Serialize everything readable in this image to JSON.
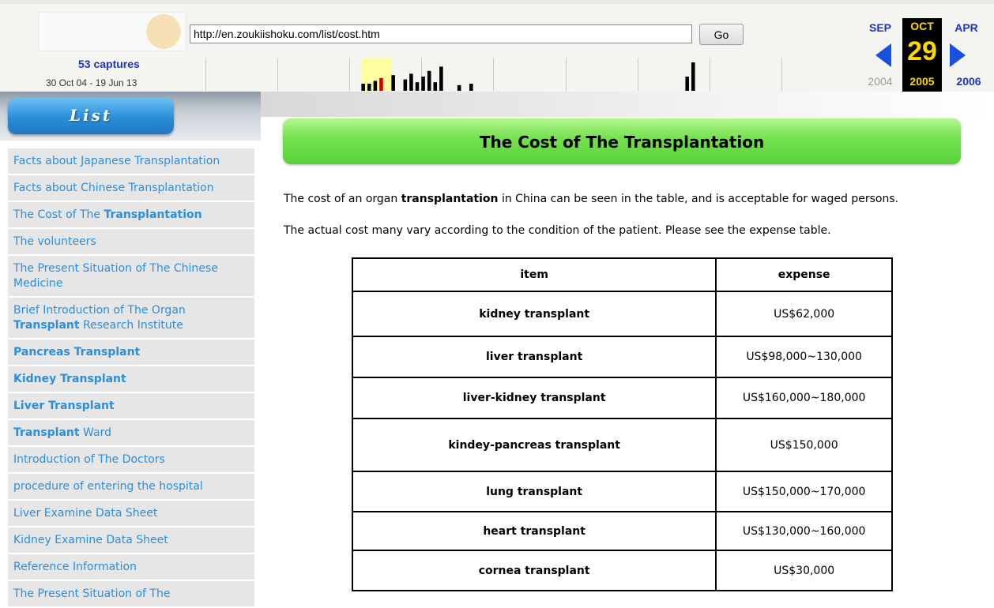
{
  "wayback": {
    "url": "http://en.zoukiishoku.com/list/cost.htm",
    "go_label": "Go",
    "captures_label": "53 captures",
    "capture_range": "30 Oct 04 - 19 Jun 13",
    "prev_month": "SEP",
    "current_month": "OCT",
    "next_month": "APR",
    "current_day": "29",
    "prev_year": "2004",
    "current_year": "2005",
    "next_year": "2006",
    "sparkline_bars": [
      {
        "month": 26,
        "height": 0.25
      },
      {
        "month": 27,
        "height": 0.25
      },
      {
        "month": 28,
        "height": 0.35
      },
      {
        "month": 29,
        "height": 0.45
      },
      {
        "month": 31,
        "height": 0.55
      },
      {
        "month": 33,
        "height": 0.4
      },
      {
        "month": 34,
        "height": 0.6
      },
      {
        "month": 35,
        "height": 0.3
      },
      {
        "month": 36,
        "height": 0.5
      },
      {
        "month": 37,
        "height": 0.7
      },
      {
        "month": 38,
        "height": 0.3
      },
      {
        "month": 39,
        "height": 0.85
      },
      {
        "month": 42,
        "height": 0.2
      },
      {
        "month": 44,
        "height": 0.25
      },
      {
        "month": 80,
        "height": 0.5
      },
      {
        "month": 81,
        "height": 1.0
      }
    ],
    "colors": {
      "accent": "#1a35c9",
      "current": "#ffd700",
      "highlight": "#ffffa0"
    }
  },
  "sidebar": {
    "title": "List",
    "items": [
      {
        "parts": [
          {
            "t": "Facts about Japanese Transplantation",
            "b": false
          }
        ]
      },
      {
        "parts": [
          {
            "t": "Facts about Chinese Transplantation",
            "b": false
          }
        ]
      },
      {
        "parts": [
          {
            "t": "The Cost of The ",
            "b": false
          },
          {
            "t": "Transplantation",
            "b": true
          }
        ]
      },
      {
        "parts": [
          {
            "t": "The volunteers",
            "b": false
          }
        ]
      },
      {
        "parts": [
          {
            "t": "The Present Situation of The Chinese Medicine",
            "b": false
          }
        ]
      },
      {
        "parts": [
          {
            "t": "Brief Introduction of The Organ ",
            "b": false
          },
          {
            "t": "Transplant",
            "b": true
          },
          {
            "t": " Research Institute",
            "b": false
          }
        ]
      },
      {
        "parts": [
          {
            "t": "Pancreas Transplant",
            "b": true
          }
        ]
      },
      {
        "parts": [
          {
            "t": "Kidney Transplant",
            "b": true
          }
        ]
      },
      {
        "parts": [
          {
            "t": "Liver Transplant",
            "b": true
          }
        ]
      },
      {
        "parts": [
          {
            "t": "Transplant",
            "b": true
          },
          {
            "t": " Ward",
            "b": false
          }
        ]
      },
      {
        "parts": [
          {
            "t": "Introduction of The Doctors",
            "b": false
          }
        ]
      },
      {
        "parts": [
          {
            "t": "procedure of entering the hospital",
            "b": false
          }
        ]
      },
      {
        "parts": [
          {
            "t": "Liver Examine Data Sheet",
            "b": false
          }
        ]
      },
      {
        "parts": [
          {
            "t": "Kidney Examine Data Sheet",
            "b": false
          }
        ]
      },
      {
        "parts": [
          {
            "t": "Reference Information",
            "b": false
          }
        ]
      },
      {
        "parts": [
          {
            "t": "The Present Situation of The",
            "b": false
          }
        ]
      }
    ]
  },
  "main": {
    "title": "The Cost of The Transplantation",
    "intro_1": {
      "before": "The cost of an organ ",
      "bold": "transplantation",
      "after": " in China can be seen in the table, and is acceptable for waged persons."
    },
    "intro_2": "The actual cost many vary according to the condition of the patient. Please see the expense table.",
    "table": {
      "headers": [
        "item",
        "expense"
      ],
      "rows": [
        [
          "kidney transplant",
          "US$62,000"
        ],
        [
          "liver transplant",
          "US$98,000~130,000"
        ],
        [
          "liver-kidney transplant",
          "US$160,000~180,000"
        ],
        [
          "kindey-pancreas transplant",
          "US$150,000"
        ],
        [
          "lung transplant",
          "US$150,000~170,000"
        ],
        [
          "heart transplant",
          "US$130,000~160,000"
        ],
        [
          "cornea transplant",
          "US$30,000"
        ]
      ]
    }
  }
}
